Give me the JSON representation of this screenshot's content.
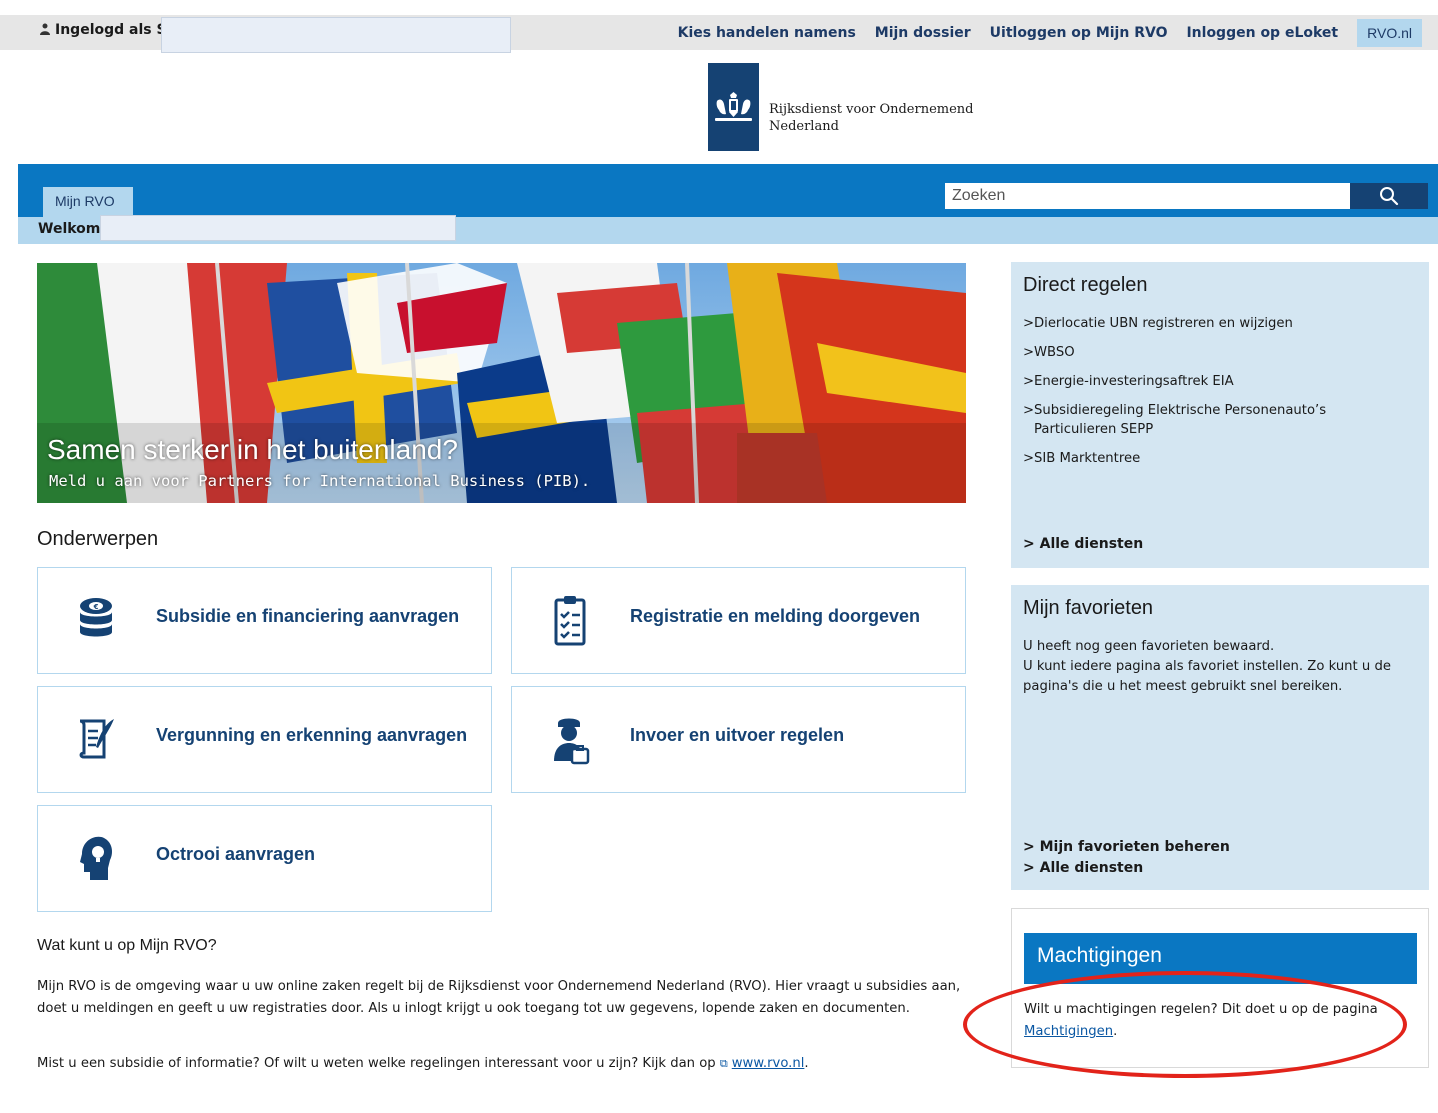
{
  "topbar": {
    "user_label": "Ingelogd als S",
    "links": [
      "Kies handelen namens",
      "Mijn dossier",
      "Uitloggen op Mijn RVO",
      "Inloggen op eLoket",
      "RVO.nl"
    ]
  },
  "logo": {
    "line1": "Rijksdienst voor Ondernemend",
    "line2": "Nederland"
  },
  "nav": {
    "tab_label": "Mijn RVO",
    "search_placeholder": "Zoeken",
    "welcome": "Welkom"
  },
  "hero": {
    "title": "Samen sterker in het buitenland?",
    "subtitle": "Meld u aan voor Partners for International Business (PIB)."
  },
  "topics": {
    "heading": "Onderwerpen",
    "items": [
      {
        "label": "Subsidie en financiering aanvragen",
        "icon": "coins-icon"
      },
      {
        "label": "Registratie en melding doorgeven",
        "icon": "clipboard-checklist-icon"
      },
      {
        "label": "Vergunning en erkenning aanvragen",
        "icon": "scroll-quill-icon"
      },
      {
        "label": "Invoer en uitvoer regelen",
        "icon": "customs-officer-icon"
      },
      {
        "label": "Octrooi aanvragen",
        "icon": "idea-head-icon"
      }
    ]
  },
  "about": {
    "heading": "Wat kunt u op Mijn RVO?",
    "body": "Mijn RVO is de omgeving waar u uw online zaken regelt bij de Rijksdienst voor Ondernemend Nederland (RVO). Hier vraagt u subsidies aan, doet u meldingen en geeft u uw registraties door. Als u inlogt krijgt u ook toegang tot uw gegevens, lopende zaken en documenten.",
    "footer_text": "Mist u een subsidie of informatie? Of wilt u weten welke regelingen interessant voor u zijn? Kijk dan op",
    "footer_link": "www.rvo.nl",
    "footer_end": "."
  },
  "direct": {
    "title": "Direct regelen",
    "items": [
      "Dierlocatie UBN registreren en wijzigen",
      "WBSO",
      "Energie-investeringsaftrek EIA",
      "Subsidieregeling Elektrische Personenauto’s Particulieren SEPP",
      "SIB Marktentree"
    ],
    "all_link": "Alle diensten"
  },
  "favorites": {
    "title": "Mijn favorieten",
    "line1": "U heeft nog geen favorieten bewaard.",
    "line2": "U kunt iedere pagina als favoriet instellen. Zo kunt u de pagina's die u het meest gebruikt snel bereiken.",
    "manage_link": "Mijn favorieten beheren",
    "all_link": "Alle diensten"
  },
  "authorizations": {
    "title": "Machtigingen",
    "text": "Wilt u machtigingen regelen? Dit doet u op de pagina",
    "link": "Machtigingen",
    "end": "."
  },
  "colors": {
    "brand_blue": "#0a77c2",
    "dark_blue": "#154273",
    "light_blue": "#b3d7ee",
    "panel_blue": "#d4e6f2",
    "annotation_red": "#e2231a"
  }
}
